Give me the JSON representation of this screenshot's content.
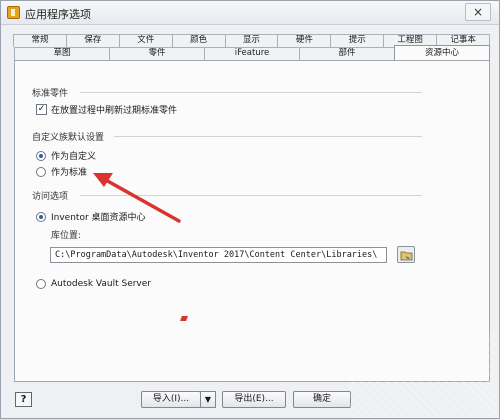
{
  "window": {
    "title": "应用程序选项",
    "close": "×"
  },
  "tabs_row1": [
    "常规",
    "保存",
    "文件",
    "颜色",
    "显示",
    "硬件",
    "提示",
    "工程图",
    "记事本"
  ],
  "tabs_row2": [
    "草图",
    "零件",
    "iFeature",
    "部件",
    "资源中心"
  ],
  "active_tab": "资源中心",
  "standard_parts": {
    "title": "标准零件",
    "refresh_checkbox_label": "在放置过程中刷新过期标准零件",
    "refresh_checked": true
  },
  "custom_family": {
    "title": "自定义族默认设置",
    "option_custom": "作为自定义",
    "option_standard": "作为标准",
    "selected": "custom"
  },
  "access": {
    "title": "访问选项",
    "option_inventor": "Inventor 桌面资源中心",
    "library_location_label": "库位置:",
    "library_path": "C:\\ProgramData\\Autodesk\\Inventor 2017\\Content Center\\Libraries\\",
    "option_vault": "Autodesk Vault Server",
    "selected": "inventor"
  },
  "footer": {
    "help": "?",
    "import": "导入(I)...",
    "export": "导出(E)...",
    "ok": "确定"
  },
  "annotation_color": "#d8352f"
}
